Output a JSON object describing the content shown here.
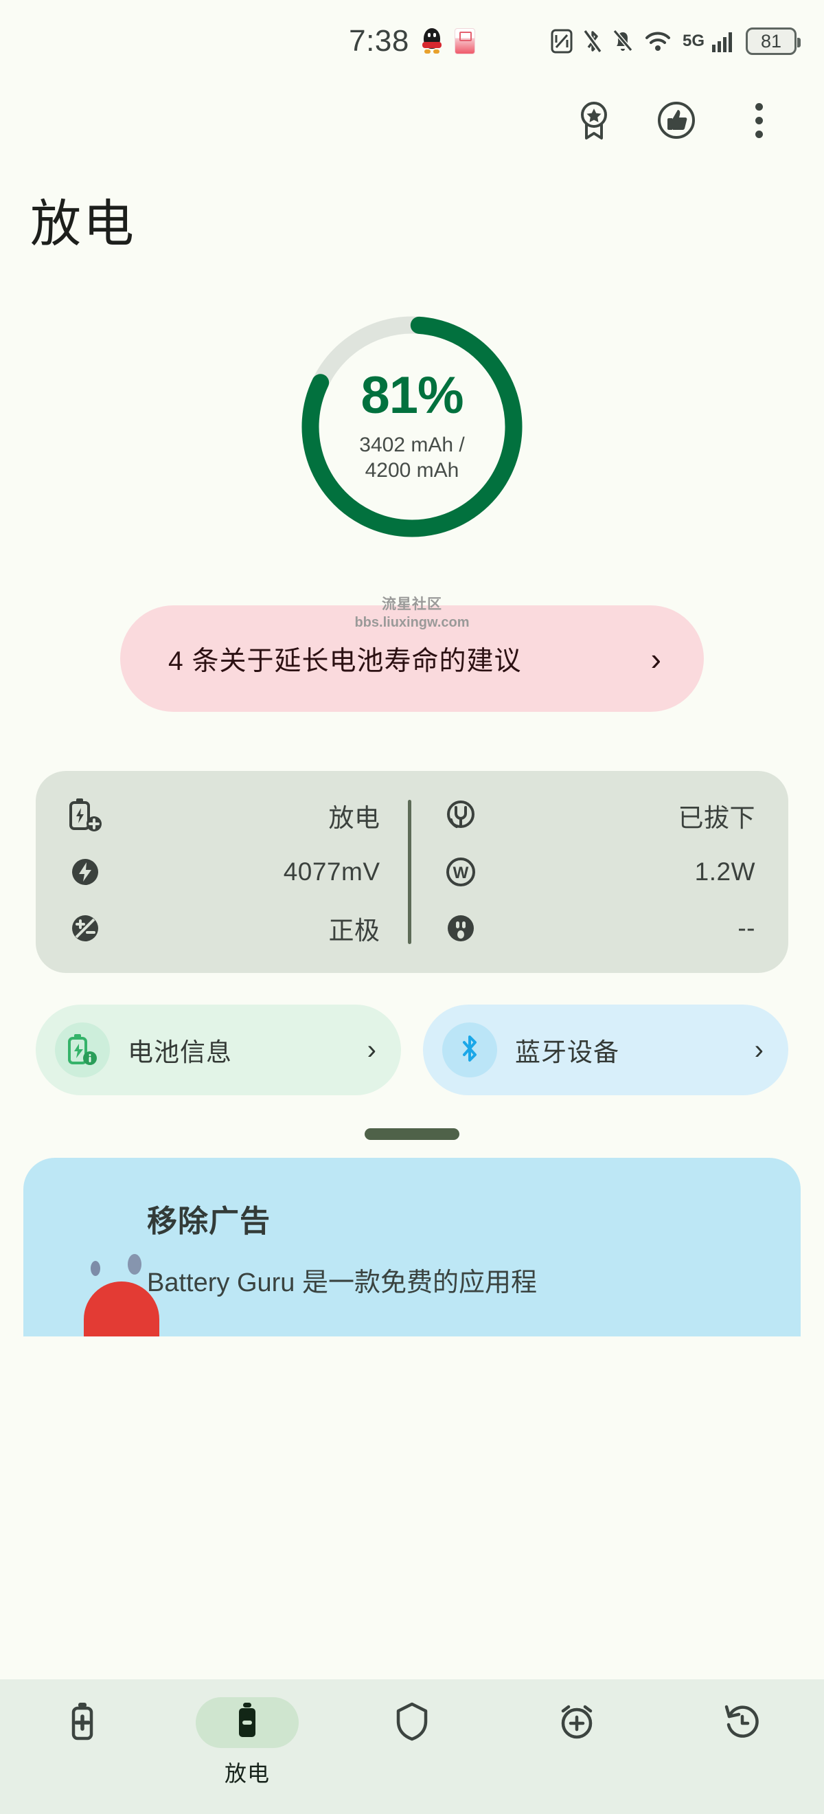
{
  "statusbar": {
    "time": "7:38",
    "battery_percent": "81",
    "network": "5G",
    "icons": [
      "qq-icon",
      "notification-icon",
      "nfc-icon",
      "bluetooth-off-icon",
      "silent-bell-icon",
      "wifi-icon",
      "5g-icon",
      "signal-bars-icon",
      "battery-icon"
    ]
  },
  "toolbar": {
    "award_label": "award-badge",
    "thumbs_up_label": "thumbs-up",
    "overflow_label": "more-options"
  },
  "page": {
    "title": "放电"
  },
  "gauge": {
    "percent_label": "81%",
    "percent_value": 81,
    "capacity_label": "3402 mAh / 4200 mAh",
    "track_color": "#dfe4dd",
    "fill_color": "#02713e"
  },
  "tip_banner": {
    "text": "4 条关于延长电池寿命的建议",
    "chevron": "›",
    "background_color": "#fadadd"
  },
  "watermark": {
    "line1": "流星社区",
    "line2": "bbs.liuxingw.com"
  },
  "info_card": {
    "background_color": "#dde4da",
    "left_rows": [
      {
        "icon": "battery-plus-icon",
        "value": "放电"
      },
      {
        "icon": "bolt-circle-icon",
        "value": "4077mV"
      },
      {
        "icon": "plus-minus-circle-icon",
        "value": "正极"
      }
    ],
    "right_rows": [
      {
        "icon": "plug-circle-icon",
        "value": "已拔下"
      },
      {
        "icon": "watt-circle-icon",
        "value": "1.2W"
      },
      {
        "icon": "outlet-circle-icon",
        "value": "--"
      }
    ]
  },
  "chips": [
    {
      "label": "电池信息",
      "icon": "battery-info-icon",
      "chevron": "›",
      "accent": "#35b36a"
    },
    {
      "label": "蓝牙设备",
      "icon": "bluetooth-icon",
      "chevron": "›",
      "accent": "#1ba7e8"
    }
  ],
  "sheet": {
    "grabber": "drag-handle",
    "ad_title": "移除广告",
    "ad_body": "Battery Guru 是一款免费的应用程"
  },
  "bottomnav": {
    "items": [
      {
        "icon": "battery-charging-icon",
        "label": "",
        "active": false
      },
      {
        "icon": "battery-discharging-icon",
        "label": "放电",
        "active": true
      },
      {
        "icon": "shield-icon",
        "label": "",
        "active": false
      },
      {
        "icon": "alarm-add-icon",
        "label": "",
        "active": false
      },
      {
        "icon": "history-icon",
        "label": "",
        "active": false
      }
    ]
  }
}
